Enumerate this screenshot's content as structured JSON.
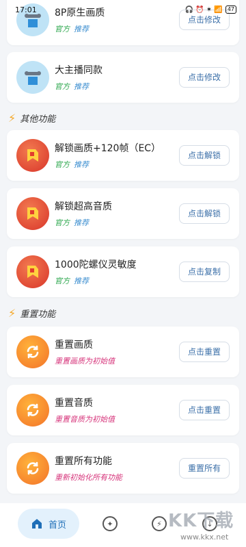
{
  "status_bar": {
    "time": "17:01",
    "icons": "🎧 ⏰ ✶ 📶",
    "battery": "47"
  },
  "sections": [
    {
      "label": "其他功能"
    },
    {
      "label": "重置功能"
    }
  ],
  "cards": [
    {
      "title": "8P原生画质",
      "sub_a": "官方",
      "sub_b": "推荐",
      "button": "点击修改",
      "icon": "tools-icon"
    },
    {
      "title": "大主播同款",
      "sub_a": "官方",
      "sub_b": "推荐",
      "button": "点击修改",
      "icon": "tools-icon"
    },
    {
      "title": "解锁画质+120帧（EC）",
      "sub_a": "官方",
      "sub_b": "推荐",
      "button": "点击解锁",
      "icon": "app-icon"
    },
    {
      "title": "解锁超高音质",
      "sub_a": "官方",
      "sub_b": "推荐",
      "button": "点击解锁",
      "icon": "app-icon"
    },
    {
      "title": "1000陀螺仪灵敏度",
      "sub_a": "官方",
      "sub_b": "推荐",
      "button": "点击复制",
      "icon": "app-icon"
    },
    {
      "title": "重置画质",
      "sub": "重置画质为初始值",
      "button": "点击重置",
      "icon": "refresh-icon"
    },
    {
      "title": "重置音质",
      "sub": "重置音质为初始值",
      "button": "点击重置",
      "icon": "refresh-icon"
    },
    {
      "title": "重置所有功能",
      "sub": "重新初始化所有功能",
      "button": "重置所有",
      "icon": "refresh-icon"
    }
  ],
  "nav": {
    "home_label": "首页"
  },
  "watermark": {
    "text": "KK下载",
    "url": "www.kkx.net"
  }
}
